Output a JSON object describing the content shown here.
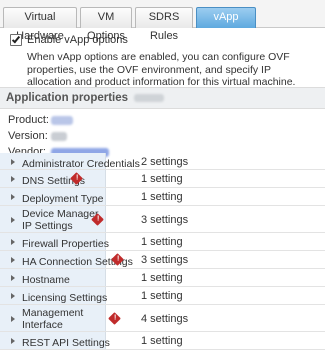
{
  "tabs": [
    {
      "label": "Virtual Hardware",
      "active": false
    },
    {
      "label": "VM Options",
      "active": false
    },
    {
      "label": "SDRS Rules",
      "active": false
    },
    {
      "label": "vApp Options",
      "active": true
    }
  ],
  "enable": {
    "label": "Enable vApp options",
    "checked": true,
    "description": "When vApp options are enabled, you can configure OVF properties, use the OVF environment, and specify IP allocation and product information for this virtual machine."
  },
  "app_properties": {
    "title": "Application properties",
    "fields": [
      {
        "label": "Product:"
      },
      {
        "label": "Version:"
      },
      {
        "label": "Vendor:"
      }
    ]
  },
  "settings_rows": [
    {
      "label": "Administrator Credentials",
      "count": "2 settings",
      "warning": false
    },
    {
      "label": "DNS Settings",
      "count": "1 setting",
      "warning": true
    },
    {
      "label": "Deployment Type",
      "count": "1 setting",
      "warning": false
    },
    {
      "label": "Device Manager IP Settings",
      "count": "3 settings",
      "warning": true
    },
    {
      "label": "Firewall Properties",
      "count": "1 setting",
      "warning": false
    },
    {
      "label": "HA Connection Settings",
      "count": "3 settings",
      "warning": true
    },
    {
      "label": "Hostname",
      "count": "1 setting",
      "warning": false
    },
    {
      "label": "Licensing Settings",
      "count": "1 setting",
      "warning": false
    },
    {
      "label": "Management Interface Settings",
      "count": "4 settings",
      "warning": true
    },
    {
      "label": "REST API Settings",
      "count": "1 setting",
      "warning": false
    }
  ],
  "colors": {
    "active_tab": "#5ea9df",
    "warning": "#c02b2b",
    "row_label_bg": "#e8f0f8"
  }
}
